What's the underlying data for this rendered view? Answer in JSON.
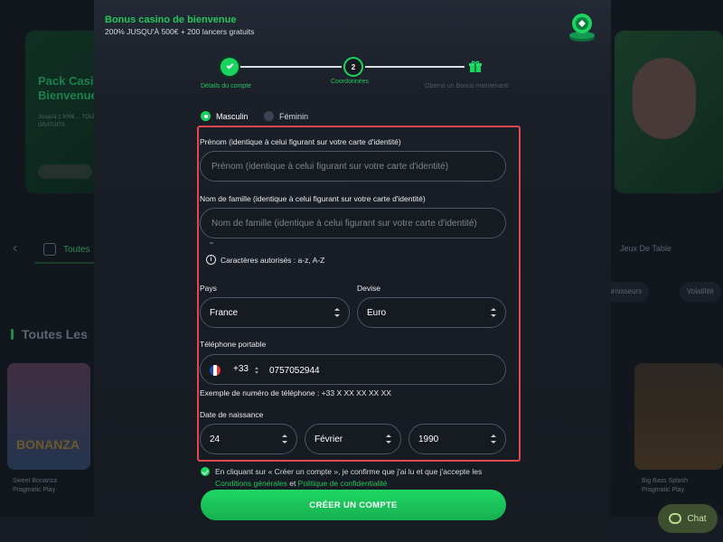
{
  "background": {
    "promo_title": "Pack Casino De Bienvenue",
    "promo_sub": "Jusqu'à 1 500€ ... TOURS GRATUITS",
    "promo_btn": "RÉCLAMER",
    "tab_left": "Toutes",
    "tab_right": "Jeux De Table",
    "pill_1": "Fournisseurs",
    "pill_2": "Volatilité",
    "section_heading": "Toutes Les",
    "card_left_label": "SWEET BONANZA",
    "card_left_title": "Sweet Bonanza",
    "card_left_provider": "Pragmatic Play",
    "card_right_title": "Big Bass Splash",
    "card_right_provider": "Pragmatic Play",
    "chat_label": "Chat"
  },
  "header": {
    "title": "Bonus casino de bienvenue",
    "subtitle": "200% JUSQU'À 500€ + 200 lancers gratuits"
  },
  "stepper": {
    "steps": [
      {
        "label": "Détails du compte",
        "state": "done"
      },
      {
        "label": "Coordonnées",
        "number": "2",
        "state": "current"
      },
      {
        "label": "Obtenir un Bonus maintenant!",
        "state": "upcoming"
      }
    ]
  },
  "gender": {
    "male": "Masculin",
    "female": "Féminin",
    "selected": "Masculin"
  },
  "form": {
    "first_name_label": "Prénom (identique à celui figurant sur votre carte d'identité)",
    "first_name_placeholder": "Prénom (identique à celui figurant sur votre carte d'identité)",
    "last_name_label": "Nom de famille (identique à celui figurant sur votre carte d'identité)",
    "last_name_placeholder": "Nom de famille (identique à celui figurant sur votre carte d'identité)",
    "allowed_chars": "Caractères autorisés : a-z, A-Z",
    "country_label": "Pays",
    "country_value": "France",
    "currency_label": "Devise",
    "currency_value": "Euro",
    "phone_label": "Téléphone portable",
    "phone_code": "+33",
    "phone_value": "0757052944",
    "phone_example": "Exemple de numéro de téléphone : +33 X XX XX XX XX",
    "dob_label": "Date de naissance",
    "dob_day": "24",
    "dob_month": "Février",
    "dob_year": "1990"
  },
  "consent": {
    "text_before": "En cliquant sur « Créer un compte », je confirme que j'ai lu et que j'accepte les ",
    "terms_link": "Conditions générales",
    "and": " et ",
    "privacy_link": "Politique de confidentialité"
  },
  "submit_label": "CRÉER UN COMPTE",
  "colors": {
    "accent": "#1bd460",
    "highlight_frame": "#e0474f",
    "modal_bg": "#161a21"
  }
}
